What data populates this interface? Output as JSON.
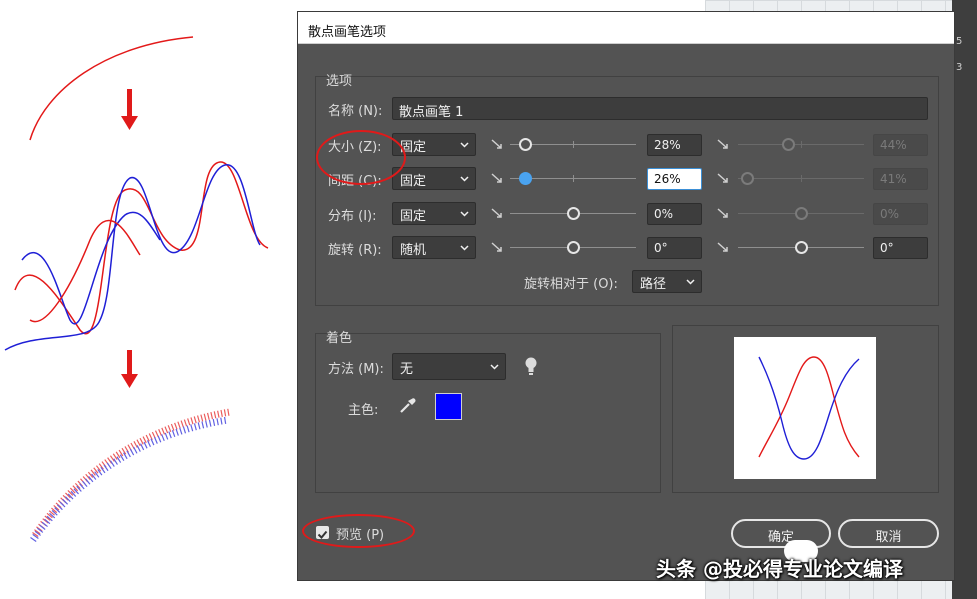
{
  "dialog": {
    "title": "散点画笔选项",
    "options_section": "选项",
    "name_label": "名称 (N):",
    "name_value": "散点画笔 1",
    "rows": [
      {
        "label": "大小 (Z):",
        "mode": "固定",
        "value": "28%",
        "value2": "44%",
        "level": 0.12,
        "level2": 0.4,
        "second_active": false
      },
      {
        "label": "间距 (C):",
        "mode": "固定",
        "value": "26%",
        "value2": "41%",
        "level": 0.12,
        "level2": 0.07,
        "second_active": false
      },
      {
        "label": "分布 (I):",
        "mode": "固定",
        "value": "0%",
        "value2": "0%",
        "level": 0.5,
        "level2": 0.5,
        "second_active": false
      },
      {
        "label": "旋转 (R):",
        "mode": "随机",
        "value": "0°",
        "value2": "0°",
        "level": 0.5,
        "level2": 0.5,
        "second_active": true
      }
    ],
    "rotate_relative_label": "旋转相对于 (O):",
    "rotate_relative_value": "路径",
    "colorize_section": "着色",
    "method_label": "方法 (M):",
    "method_value": "无",
    "key_color_label": "主色:",
    "key_color": "#0000ff",
    "preview_label": "预览 (P)",
    "ok_label": "确定",
    "cancel_label": "取消"
  },
  "side_labels": [
    "5",
    "3"
  ],
  "watermark": "头条 @投必得专业论文编译",
  "colors": {
    "dialog_bg": "#535353",
    "curve_red": "#e31919",
    "curve_blue": "#1f1fd6",
    "highlight": "#4aa3f0"
  },
  "icons": [
    "chevron-down-icon",
    "slider-min-icon",
    "slider-max-icon",
    "lightbulb-icon",
    "eyedropper-icon",
    "checkmark-icon"
  ]
}
